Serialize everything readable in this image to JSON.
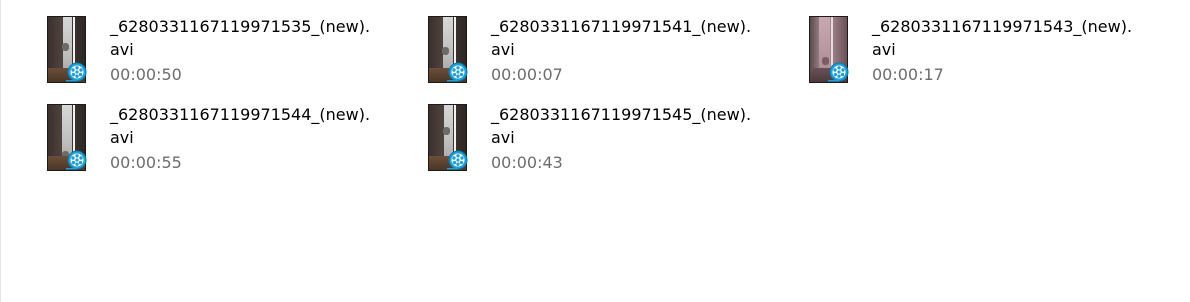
{
  "files": [
    {
      "name_line1": "_6280331167119971535_(new).",
      "name_line2": "avi",
      "duration": "00:00:50",
      "icon": "media-player-film-icon"
    },
    {
      "name_line1": "_6280331167119971541_(new).",
      "name_line2": "avi",
      "duration": "00:00:07",
      "icon": "media-player-film-icon"
    },
    {
      "name_line1": "_6280331167119971543_(new).",
      "name_line2": "avi",
      "duration": "00:00:17",
      "icon": "media-player-film-icon"
    },
    {
      "name_line1": "_6280331167119971544_(new).",
      "name_line2": "avi",
      "duration": "00:00:55",
      "icon": "media-player-film-icon"
    },
    {
      "name_line1": "_6280331167119971545_(new).",
      "name_line2": "avi",
      "duration": "00:00:43",
      "icon": "media-player-film-icon"
    }
  ],
  "colors": {
    "filename_text": "#000000",
    "duration_text": "#6d6d6d",
    "badge_blue": "#1fa0d8"
  }
}
